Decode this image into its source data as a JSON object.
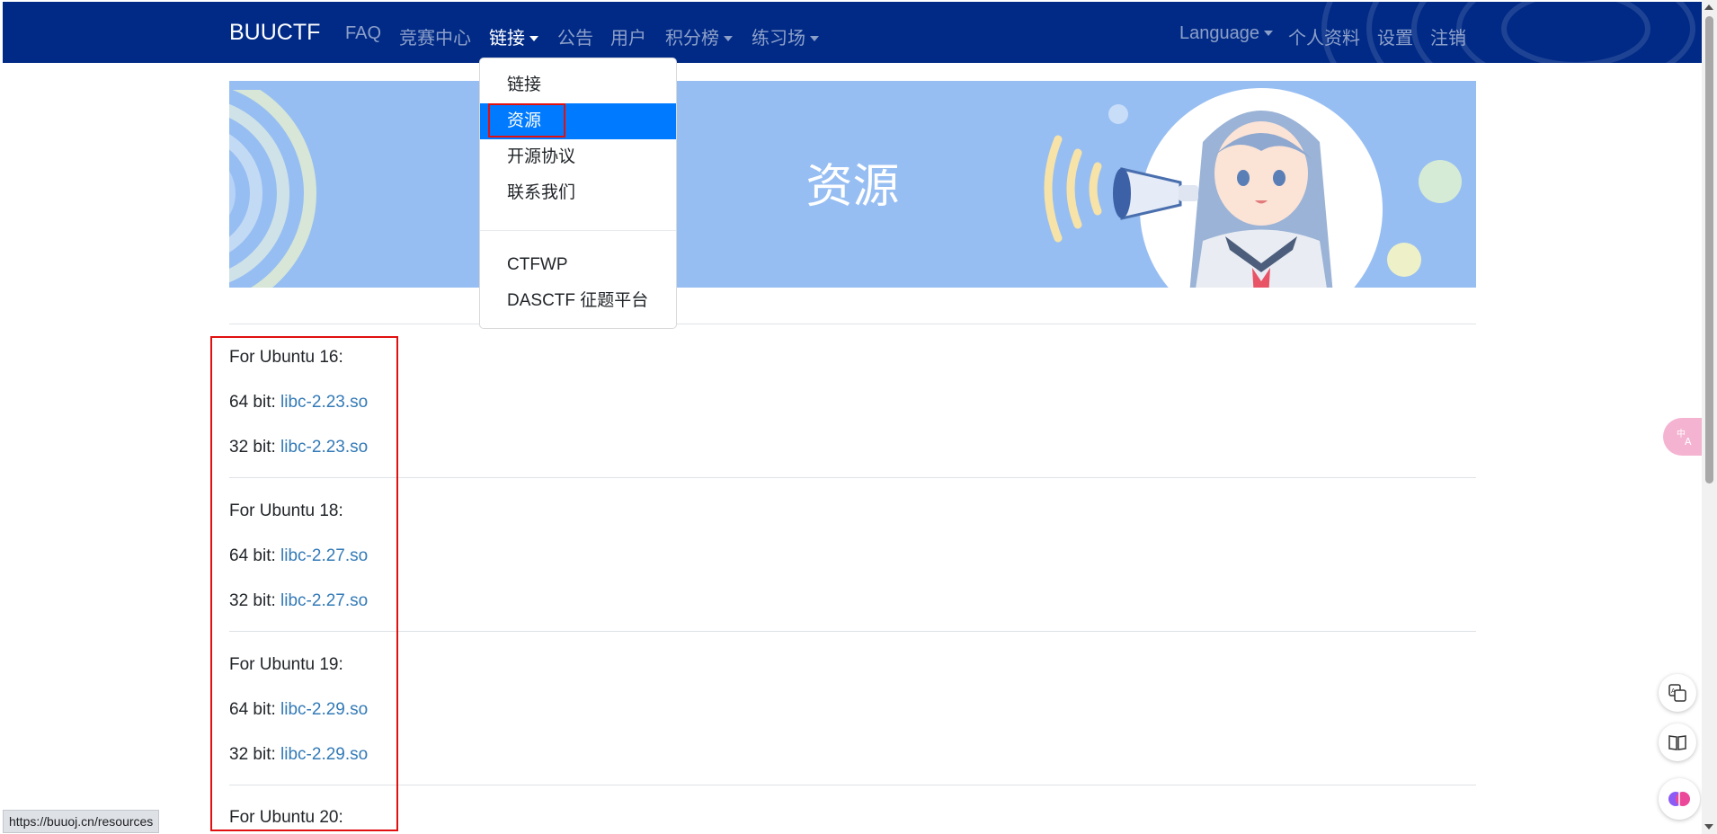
{
  "navbar": {
    "brand": "BUUCTF",
    "items": [
      {
        "label": "FAQ"
      },
      {
        "label": "竞赛中心"
      },
      {
        "label": "链接"
      },
      {
        "label": "公告"
      },
      {
        "label": "用户"
      },
      {
        "label": "积分榜"
      },
      {
        "label": "练习场"
      }
    ],
    "right_items": [
      {
        "label": "Language"
      },
      {
        "label": "个人资料"
      },
      {
        "label": "设置"
      },
      {
        "label": "注销"
      }
    ]
  },
  "dropdown": {
    "items": [
      {
        "label": "链接"
      },
      {
        "label": "资源"
      },
      {
        "label": "开源协议"
      },
      {
        "label": "联系我们"
      },
      {
        "label": "CTFWP"
      },
      {
        "label": "DASCTF 征题平台"
      }
    ]
  },
  "hero": {
    "title": "资源"
  },
  "sections": [
    {
      "heading": "For Ubuntu 16:",
      "lines": [
        {
          "prefix": "64 bit: ",
          "link": "libc-2.23.so"
        },
        {
          "prefix": "32 bit: ",
          "link": "libc-2.23.so"
        }
      ]
    },
    {
      "heading": "For Ubuntu 18:",
      "lines": [
        {
          "prefix": "64 bit: ",
          "link": "libc-2.27.so"
        },
        {
          "prefix": "32 bit: ",
          "link": "libc-2.27.so"
        }
      ]
    },
    {
      "heading": "For Ubuntu 19:",
      "lines": [
        {
          "prefix": "64 bit: ",
          "link": "libc-2.29.so"
        },
        {
          "prefix": "32 bit: ",
          "link": "libc-2.29.so"
        }
      ]
    },
    {
      "heading": "For Ubuntu 20:",
      "lines": []
    }
  ],
  "status_bar": {
    "url": "https://buuoj.cn/resources"
  },
  "colors": {
    "navbar": "#002a86",
    "hero": "#97bef2",
    "active_item": "#007bff",
    "link": "#337ab7",
    "highlight": "#e11010"
  },
  "icons": [
    "caret-down-icon",
    "translate-icon",
    "reading-mode-icon",
    "ai-brain-icon"
  ]
}
